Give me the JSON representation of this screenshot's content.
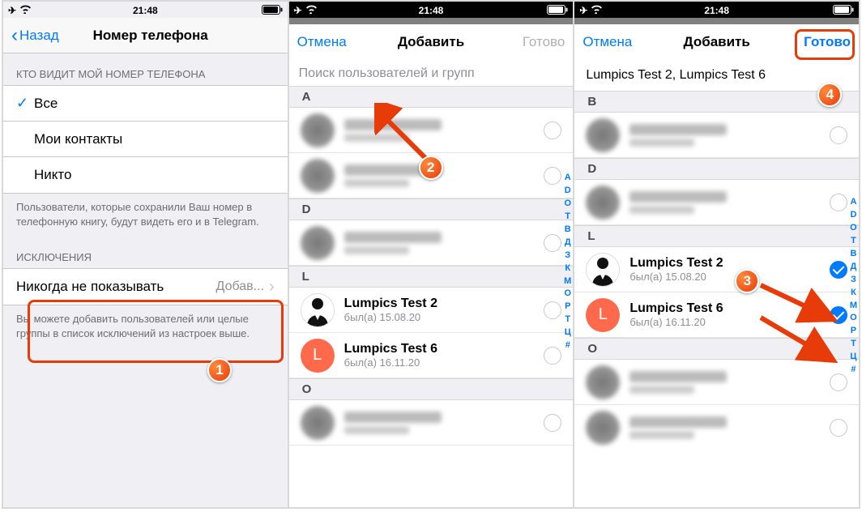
{
  "status": {
    "time": "21:48"
  },
  "screen1": {
    "back": "Назад",
    "title": "Номер телефона",
    "who_header": "КТО ВИДИТ МОЙ НОМЕР ТЕЛЕФОНА",
    "options": {
      "all": "Все",
      "contacts": "Мои контакты",
      "nobody": "Никто"
    },
    "who_footer": "Пользователи, которые сохранили Ваш номер в телефонную книгу, будут видеть его и в Telegram.",
    "exc_header": "ИСКЛЮЧЕНИЯ",
    "never_show": "Никогда не показывать",
    "never_value": "Добав...",
    "exc_footer": "Вы можете добавить пользователей или целые группы в список исключений из настроек выше."
  },
  "screen2": {
    "cancel": "Отмена",
    "title": "Добавить",
    "done": "Готово",
    "search_placeholder": "Поиск пользователей и групп",
    "letters": [
      "A",
      "D",
      "L",
      "O"
    ],
    "lumpics2": {
      "name": "Lumpics Test 2",
      "sub": "был(а) 15.08.20"
    },
    "lumpics6": {
      "name": "Lumpics Test 6",
      "sub": "был(а) 16.11.20",
      "letter": "L"
    }
  },
  "screen3": {
    "cancel": "Отмена",
    "title": "Добавить",
    "done": "Готово",
    "selected": "Lumpics Test 2,  Lumpics Test 6",
    "letters": [
      "B",
      "D",
      "L",
      "O"
    ],
    "lumpics2": {
      "name": "Lumpics Test 2",
      "sub": "был(а) 15.08.20"
    },
    "lumpics6": {
      "name": "Lumpics Test 6",
      "sub": "был(а) 16.11.20",
      "letter": "L"
    }
  },
  "alpha_index": [
    "A",
    "D",
    "O",
    "T",
    "В",
    "Д",
    "З",
    "К",
    "М",
    "О",
    "Р",
    "Т",
    "Ц",
    "#"
  ],
  "steps": {
    "1": "1",
    "2": "2",
    "3": "3",
    "4": "4"
  }
}
